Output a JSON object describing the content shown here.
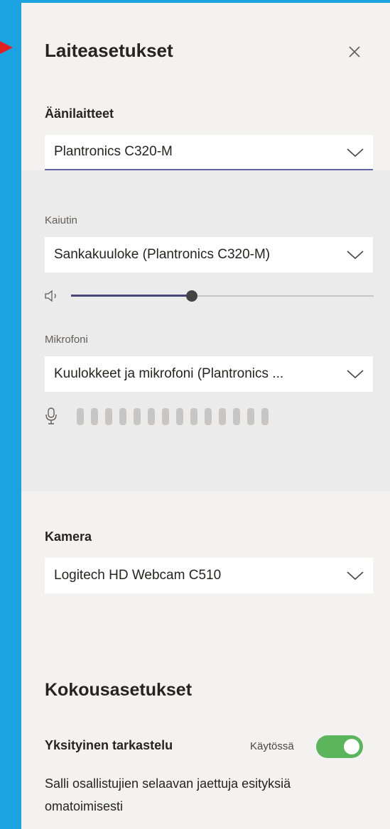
{
  "title": "Laiteasetukset",
  "audio": {
    "label": "Äänilaitteet",
    "device": "Plantronics C320-M",
    "speaker_label": "Kaiutin",
    "speaker_device": "Sankakuuloke (Plantronics C320-M)",
    "volume_fraction": 0.4,
    "microphone_label": "Mikrofoni",
    "microphone_device": "Kuulokkeet ja mikrofoni (Plantronics ...",
    "mic_level_segments": 14
  },
  "camera": {
    "label": "Kamera",
    "device": "Logitech HD Webcam C510"
  },
  "meeting": {
    "heading": "Kokousasetukset",
    "private_view_label": "Yksityinen tarkastelu",
    "toggle_state_text": "Käytössä",
    "toggle_on": true,
    "description": "Salli osallistujien selaavan jaettuja esityksiä omatoimisesti"
  },
  "colors": {
    "window_edge": "#1aa3e0",
    "accent": "#6264a7",
    "toggle_on": "#5bb65b",
    "arrow": "#e02020"
  }
}
